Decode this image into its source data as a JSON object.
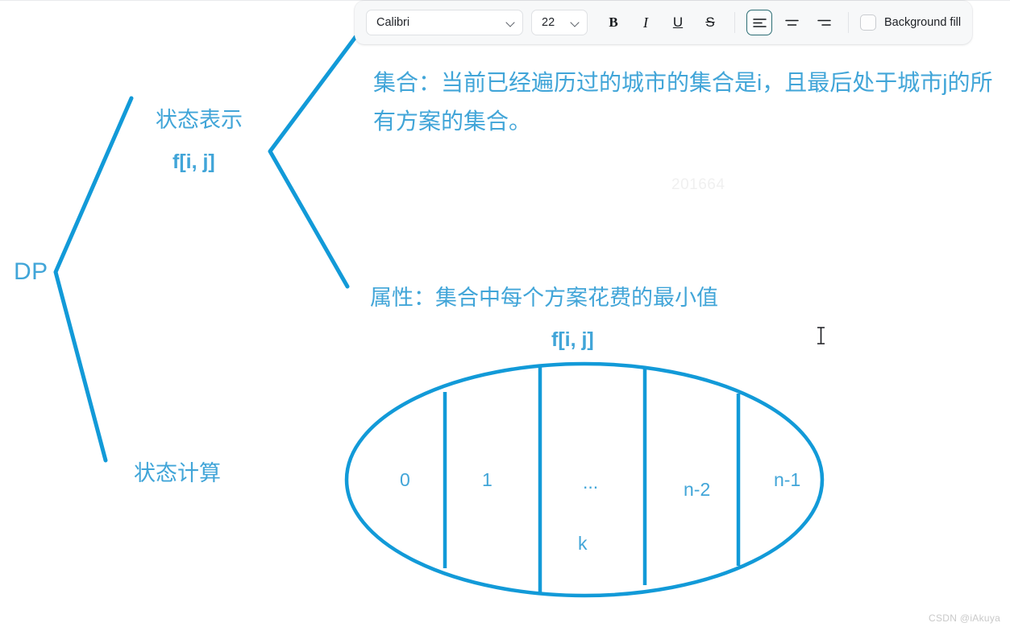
{
  "toolbar": {
    "font_family": "Calibri",
    "font_size": "22",
    "bold_label": "B",
    "italic_label": "I",
    "underline_label": "U",
    "strikethrough_label": "S",
    "align_left_name": "align-left",
    "align_center_name": "align-center",
    "align_right_name": "align-right",
    "active_alignment": "align-left",
    "background_fill_label": "Background fill",
    "background_fill_checked": false,
    "accent_selected_color": "#2c6d74"
  },
  "canvas": {
    "ink_color": "#129ad8",
    "text_color": "#41a5d8",
    "root_label": "DP",
    "branch_state_representation": {
      "title": "状态表示",
      "formula": "f[i, j]"
    },
    "branch_state_calculation": {
      "title": "状态计算"
    },
    "set_description": "集合：当前已经遍历过的城市的集合是i，且最后处于城市j的所有方案的集合。",
    "attribute_description": "属性：集合中每个方案花费的最小值",
    "attribute_formula": "f[i, j]",
    "partition_diagram": {
      "cells": [
        "0",
        "1",
        "...",
        "n-2",
        "n-1"
      ],
      "sub_label": "k"
    }
  },
  "watermarks": {
    "center": "201664",
    "bottom_right": "CSDN @iAkuya"
  }
}
